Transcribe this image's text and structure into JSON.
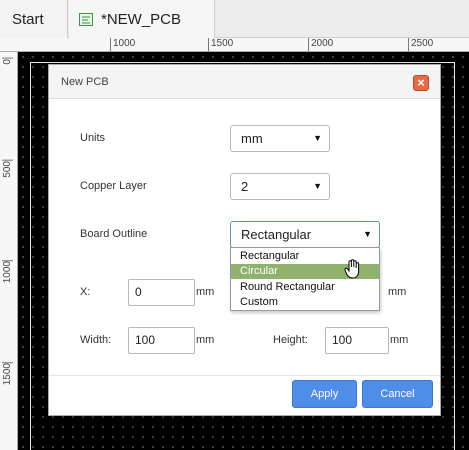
{
  "tabs": [
    {
      "label": "Start"
    },
    {
      "label": "*NEW_PCB",
      "icon": "pcb-icon"
    }
  ],
  "ruler": {
    "top_labels": [
      "1000",
      "1500",
      "2000",
      "2500"
    ],
    "left_labels": [
      "0",
      "500",
      "1000",
      "1500"
    ]
  },
  "dialog": {
    "title": "New PCB",
    "units_label": "Units",
    "units_value": "mm",
    "copper_label": "Copper Layer",
    "copper_value": "2",
    "outline_label": "Board Outline",
    "outline_value": "Rectangular",
    "outline_options": [
      "Rectangular",
      "Circular",
      "Round Rectangular",
      "Custom"
    ],
    "outline_highlighted": "Circular",
    "x_label": "X:",
    "x_value": "0",
    "x_unit": "mm",
    "y_unit": "mm",
    "width_label": "Width:",
    "width_value": "100",
    "width_unit": "mm",
    "height_label": "Height:",
    "height_value": "100",
    "height_unit": "mm",
    "apply_label": "Apply",
    "cancel_label": "Cancel"
  },
  "colors": {
    "accent": "#4f8ee8",
    "close": "#e66a42",
    "highlight": "#8fb16d",
    "canvas": "#000000"
  }
}
